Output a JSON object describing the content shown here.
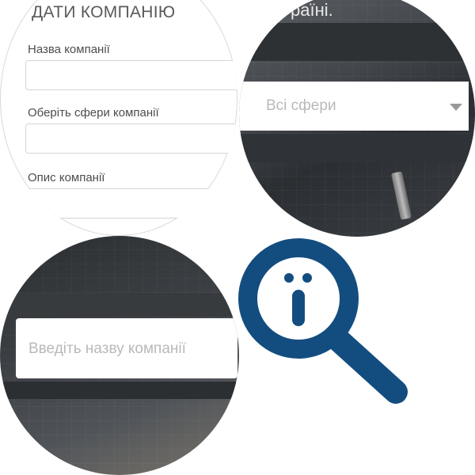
{
  "form_panel": {
    "title": "ДАТИ КОМПАНІЮ",
    "name_label": "Назва компанії",
    "spheres_label": "Оберіть сфери компанії",
    "description_label": "Опис компанії"
  },
  "dropdown_panel": {
    "top_text": "раїні.",
    "select_value": "Всі сфери"
  },
  "search_panel": {
    "input_placeholder": "Введіть назву компанії"
  },
  "icon": {
    "name": "magnifier-info-icon",
    "color": "#134d80"
  }
}
